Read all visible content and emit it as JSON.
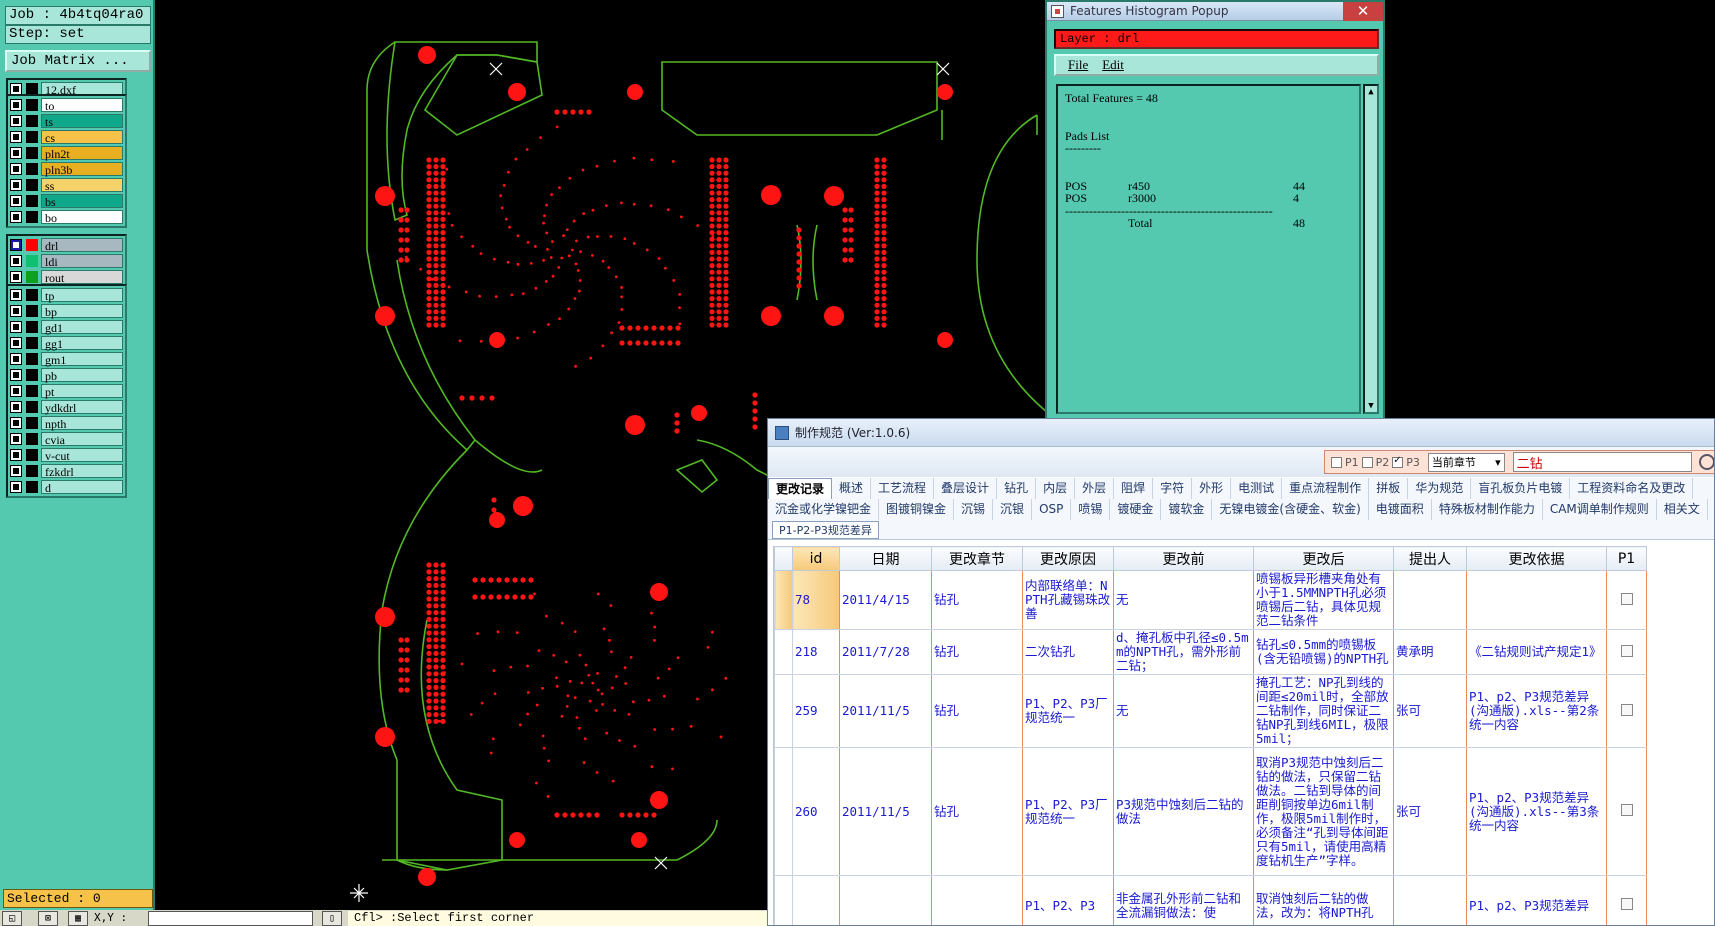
{
  "left_panel": {
    "job_label": "Job : 4b4tq04ra0",
    "step_label": "Step: set",
    "job_matrix_button": "Job Matrix ...",
    "layer_groups": [
      [
        {
          "name": "12.dxf",
          "color": "#a8e6da",
          "on": false
        }
      ],
      [
        {
          "name": "to",
          "color": "#ffffff",
          "on": false
        },
        {
          "name": "ts",
          "color": "#10a88a",
          "on": false
        },
        {
          "name": "cs",
          "color": "#f6c24a",
          "on": false
        },
        {
          "name": "pln2t",
          "color": "#e8b020",
          "on": false
        },
        {
          "name": "pln3b",
          "color": "#e8b020",
          "on": false
        },
        {
          "name": "ss",
          "color": "#f6d26a",
          "on": false
        },
        {
          "name": "bs",
          "color": "#10a88a",
          "on": false
        },
        {
          "name": "bo",
          "color": "#ffffff",
          "on": false
        }
      ],
      [
        {
          "name": "drl",
          "color": "#a8b8c0",
          "on": true,
          "marker": "#ff0000"
        },
        {
          "name": "ldi",
          "color": "#a8b8c0",
          "on": false,
          "marker": "#10c070"
        },
        {
          "name": "rout",
          "color": "#d8d8d8",
          "on": false,
          "marker": "#10a020"
        }
      ],
      [
        {
          "name": "tp",
          "color": "#a8e6da",
          "on": false
        },
        {
          "name": "bp",
          "color": "#a8e6da",
          "on": false
        },
        {
          "name": "gd1",
          "color": "#a8e6da",
          "on": false
        },
        {
          "name": "gg1",
          "color": "#a8e6da",
          "on": false
        },
        {
          "name": "gm1",
          "color": "#a8e6da",
          "on": false
        },
        {
          "name": "pb",
          "color": "#a8e6da",
          "on": false
        },
        {
          "name": "pt",
          "color": "#a8e6da",
          "on": false
        },
        {
          "name": "ydkdrl",
          "color": "#a8e6da",
          "on": false
        },
        {
          "name": "npth",
          "color": "#a8e6da",
          "on": false
        },
        {
          "name": "cvia",
          "color": "#a8e6da",
          "on": false
        },
        {
          "name": "v-cut",
          "color": "#a8e6da",
          "on": false
        },
        {
          "name": "fzkdrl",
          "color": "#a8e6da",
          "on": false
        },
        {
          "name": "d",
          "color": "#a8e6da",
          "on": false
        }
      ]
    ],
    "selected_label": "Selected : 0"
  },
  "statusbar": {
    "xy_label": "X,Y :",
    "prompt": "Cfl> :Select first corner"
  },
  "histogram": {
    "title": "Features Histogram Popup",
    "close": "✕",
    "layer_line": "Layer : drl",
    "menu_file": "File",
    "menu_edit": "Edit",
    "total_line": "Total Features = 48",
    "pads_title": "Pads List",
    "pads_rule": "---------",
    "rows": [
      {
        "pos": "POS",
        "sym": "r450",
        "count": "44"
      },
      {
        "pos": "POS",
        "sym": "r3000",
        "count": "4"
      }
    ],
    "total_rule": "----------------------------------------------------",
    "total_label": "Total",
    "total_count": "48"
  },
  "spec": {
    "title": "制作规范 (Ver:1.0.6)",
    "filter": {
      "p1": "P1",
      "p2": "P2",
      "p3": "P3",
      "p1_checked": false,
      "p2_checked": false,
      "p3_checked": true,
      "chapter": "当前章节",
      "search": "二钻"
    },
    "tabs_row1": [
      "更改记录",
      "概述",
      "工艺流程",
      "叠层设计",
      "钻孔",
      "内层",
      "外层",
      "阻焊",
      "字符",
      "外形",
      "电测试",
      "重点流程制作",
      "拼板",
      "华为规范",
      "盲孔板负片电镀",
      "工程资料命名及更改"
    ],
    "tabs_row2": [
      "沉金或化学镍钯金",
      "图镀铜镍金",
      "沉锡",
      "沉银",
      "OSP",
      "喷锡",
      "镀硬金",
      "镀软金",
      "无镍电镀金(含硬金、软金)",
      "电镀面积",
      "特殊板材制作能力",
      "CAM调单制作规则",
      "相关文"
    ],
    "subtab": "P1-P2-P3规范差异",
    "columns": [
      "id",
      "日期",
      "更改章节",
      "更改原因",
      "更改前",
      "更改后",
      "提出人",
      "更改依据",
      "P1"
    ],
    "rows": [
      {
        "id": "78",
        "date": "2011/4/15",
        "chapter": "钻孔",
        "reason": "内部联络单：NPTH孔藏锡珠改善",
        "before": "无",
        "after": "喷锡板异形槽夹角处有小于1.5MMNPTH孔必须喷锡后二钻，具体见规范二钻条件",
        "person": "",
        "basis": ""
      },
      {
        "id": "218",
        "date": "2011/7/28",
        "chapter": "钻孔",
        "reason": "二次钻孔",
        "before": "d、掩孔板中孔径≤0.5mm的NPTH孔，需外形前二钻；",
        "after": "钻孔≤0.5mm的喷锡板(含无铅喷锡)的NPTH孔",
        "person": "黄承明",
        "basis": "《二钻规则试产规定1》"
      },
      {
        "id": "259",
        "date": "2011/11/5",
        "chapter": "钻孔",
        "reason": "P1、P2、P3厂规范统一",
        "before": "无",
        "after": "掩孔工艺：NP孔到线的间距≤20mil时，全部放二钻制作，同时保证二钻NP孔到线6MIL，极限5mil；",
        "person": "张可",
        "basis": "P1、p2、P3规范差异(沟通版).xls--第2条统一内容"
      },
      {
        "id": "260",
        "date": "2011/11/5",
        "chapter": "钻孔",
        "reason": "P1、P2、P3厂规范统一",
        "before": "P3规范中蚀刻后二钻的做法",
        "after": "取消P3规范中蚀刻后二钻的做法，只保留二钻做法。二钻到导体的间距削铜按单边6mil制作，极限5mil制作时，必须备注“孔到导体间距只有5mil，请使用高精度钻机生产”字样。",
        "person": "张可",
        "basis": "P1、p2、P3规范差异(沟通版).xls--第3条统一内容"
      },
      {
        "id": "",
        "date": "",
        "chapter": "",
        "reason": "P1、P2、P3",
        "before": "非金属孔外形前二钻和全流漏铜做法：使",
        "after": "取消蚀刻后二钻的做法，改为：将NPTH孔",
        "person": "",
        "basis": "P1、p2、P3规范差异"
      }
    ]
  }
}
